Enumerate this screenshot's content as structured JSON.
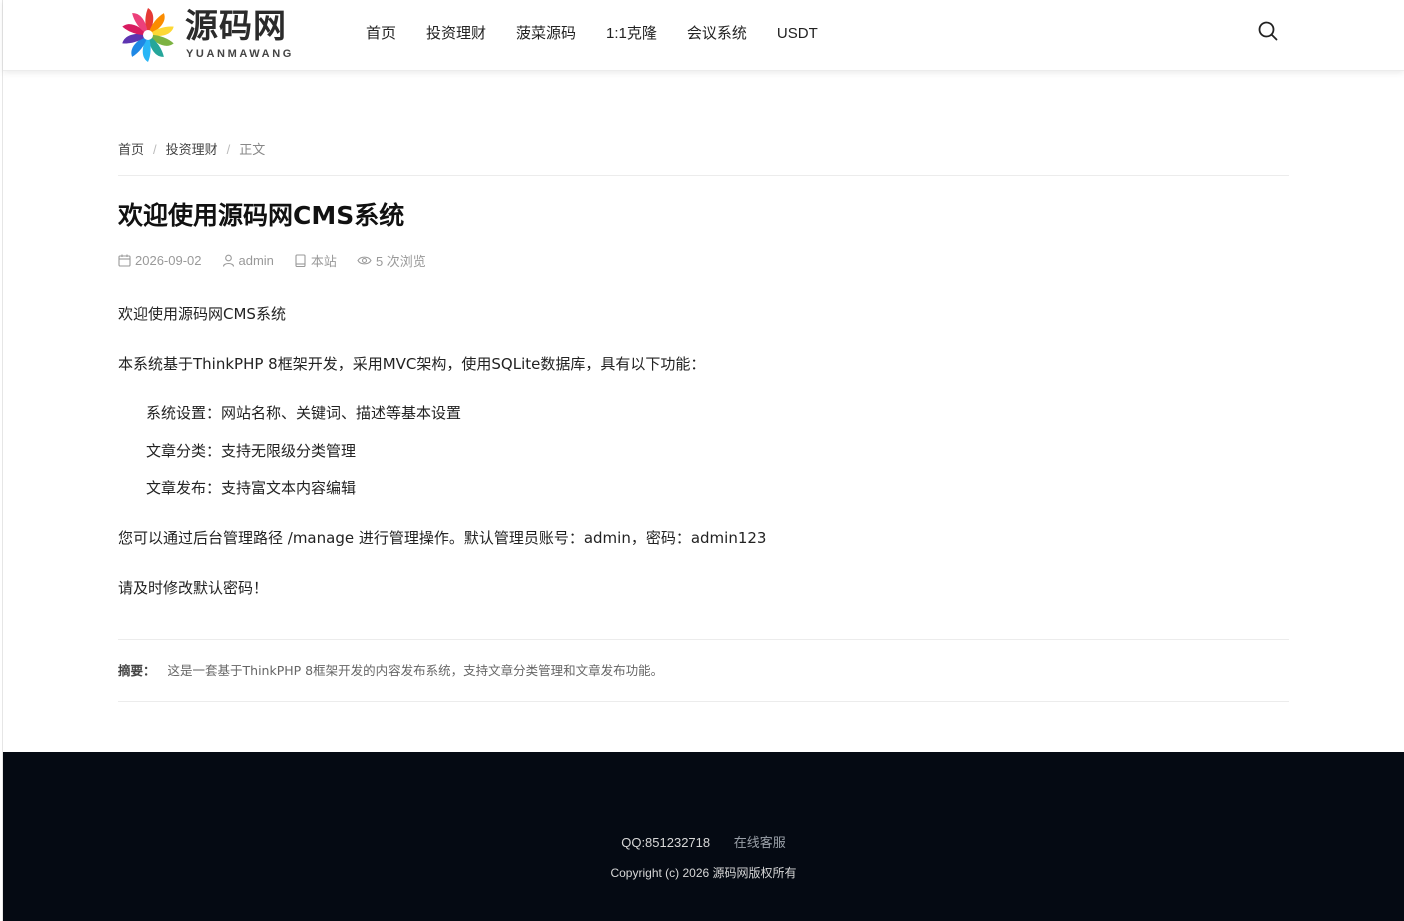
{
  "logo": {
    "text": "源码网",
    "sub": "YUANMAWANG"
  },
  "nav": [
    "首页",
    "投资理财",
    "菠菜源码",
    "1:1克隆",
    "会议系统",
    "USDT"
  ],
  "breadcrumb": {
    "home": "首页",
    "category": "投资理财",
    "current": "正文"
  },
  "article": {
    "title": "欢迎使用源码网CMS系统",
    "date": "2026-09-02",
    "author": "admin",
    "source": "本站",
    "views": "5 次浏览",
    "paragraphs": [
      "欢迎使用源码网CMS系统",
      "本系统基于ThinkPHP 8框架开发，采用MVC架构，使用SQLite数据库，具有以下功能：",
      "您可以通过后台管理路径 /manage 进行管理操作。默认管理员账号：admin，密码：admin123",
      "请及时修改默认密码！"
    ],
    "list": [
      "系统设置：网站名称、关键词、描述等基本设置",
      "文章分类：支持无限级分类管理",
      "文章发布：支持富文本内容编辑"
    ],
    "summary_label": "摘要：",
    "summary": "这是一套基于ThinkPHP 8框架开发的内容发布系统，支持文章分类管理和文章发布功能。"
  },
  "footer": {
    "qq": "QQ:851232718",
    "service": "在线客服",
    "copyright": "Copyright (c) 2026 源码网版权所有"
  },
  "icons": {
    "search": "search-icon",
    "calendar": "calendar-icon",
    "user": "user-icon",
    "book": "book-icon",
    "eye": "eye-icon"
  }
}
